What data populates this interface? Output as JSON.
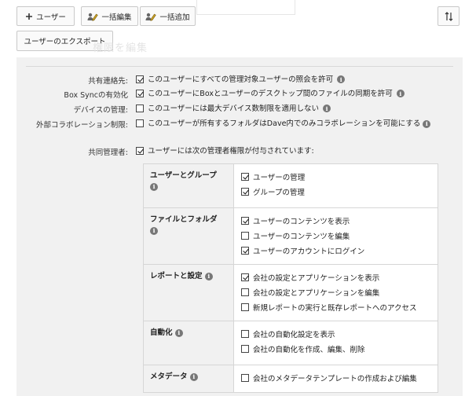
{
  "toolbar": {
    "add_user_label": "ユーザー",
    "bulk_edit_label": "一括編集",
    "bulk_add_label": "一括追加",
    "export_label": "ユーザーのエクスポート"
  },
  "section": {
    "title": "権限を編集"
  },
  "settings": [
    {
      "label": "共有連絡先:",
      "text": "このユーザーにすべての管理対象ユーザーの照会を許可",
      "checked": true,
      "info": true
    },
    {
      "label": "Box Syncの有効化",
      "text": "このユーザーにBoxとユーザーのデスクトップ間のファイルの同期を許可",
      "checked": true,
      "info": true
    },
    {
      "label": "デバイスの管理:",
      "text": "このユーザーには最大デバイス数制限を適用しない",
      "checked": false,
      "info": true
    },
    {
      "label": "外部コラボレーション制限:",
      "text": "このユーザーが所有するフォルダはDave内でのみコラボレーションを可能にする",
      "checked": false,
      "info": true
    },
    {
      "label": "共同管理者:",
      "text": "ユーザーには次の管理者権限が付与されています:",
      "checked": true,
      "info": false
    }
  ],
  "permissions": [
    {
      "group": "ユーザーとグループ",
      "options": [
        {
          "label": "ユーザーの管理",
          "checked": true
        },
        {
          "label": "グループの管理",
          "checked": true
        }
      ]
    },
    {
      "group": "ファイルとフォルダ",
      "options": [
        {
          "label": "ユーザーのコンテンツを表示",
          "checked": true
        },
        {
          "label": "ユーザーのコンテンツを編集",
          "checked": false
        },
        {
          "label": "ユーザーのアカウントにログイン",
          "checked": true
        }
      ]
    },
    {
      "group": "レポートと設定",
      "options": [
        {
          "label": "会社の設定とアプリケーションを表示",
          "checked": true
        },
        {
          "label": "会社の設定とアプリケーションを編集",
          "checked": false
        },
        {
          "label": "新規レポートの実行と既存レポートへのアクセス",
          "checked": false
        }
      ]
    },
    {
      "group": "自動化",
      "options": [
        {
          "label": "会社の自動化設定を表示",
          "checked": false
        },
        {
          "label": "会社の自動化を作成、編集、削除",
          "checked": false
        }
      ]
    },
    {
      "group": "メタデータ",
      "options": [
        {
          "label": "会社のメタデータテンプレートの作成および編集",
          "checked": false
        }
      ]
    }
  ],
  "icons": {
    "plus": "plus-icon",
    "bulk_edit": "pencil-people-icon",
    "bulk_add": "pencil-people-icon",
    "sort": "sort-arrows-icon",
    "info": "info-icon"
  }
}
